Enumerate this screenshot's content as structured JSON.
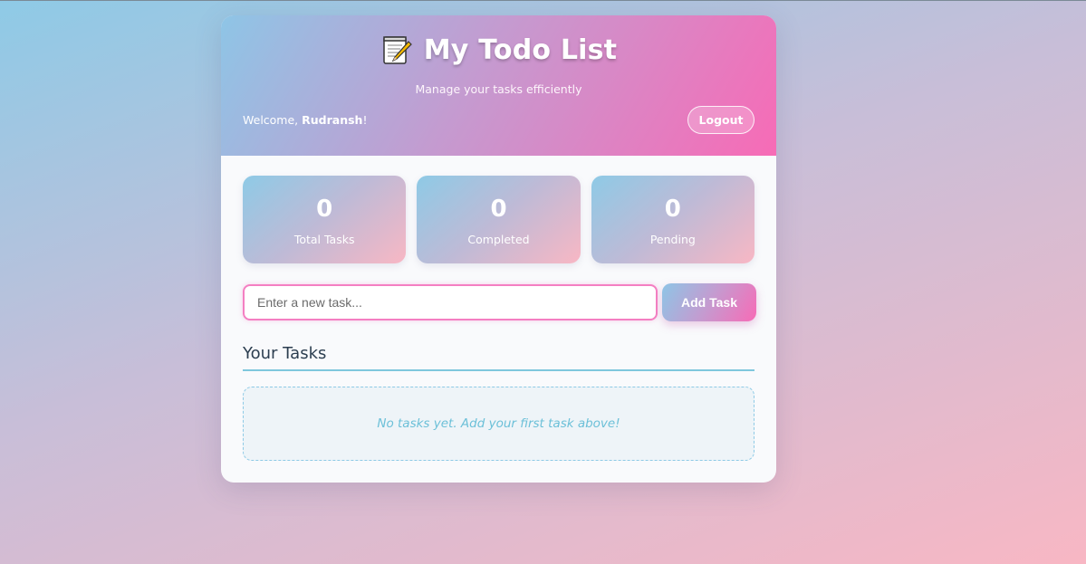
{
  "header": {
    "icon": "memo-icon",
    "title": "My Todo List",
    "subtitle": "Manage your tasks efficiently",
    "welcome_prefix": "Welcome, ",
    "username": "Rudransh",
    "welcome_suffix": "!",
    "logout_label": "Logout"
  },
  "stats": [
    {
      "value": "0",
      "label": "Total Tasks"
    },
    {
      "value": "0",
      "label": "Completed"
    },
    {
      "value": "0",
      "label": "Pending"
    }
  ],
  "new_task": {
    "value": "",
    "placeholder": "Enter a new task...",
    "add_label": "Add Task"
  },
  "tasks": {
    "heading": "Your Tasks",
    "empty_message": "No tasks yet. Add your first task above!"
  },
  "colors": {
    "accent_pink": "#f76bb6",
    "accent_blue": "#8ec5e6",
    "heading_text": "#2c3e50",
    "empty_text": "#6cc0d8"
  }
}
